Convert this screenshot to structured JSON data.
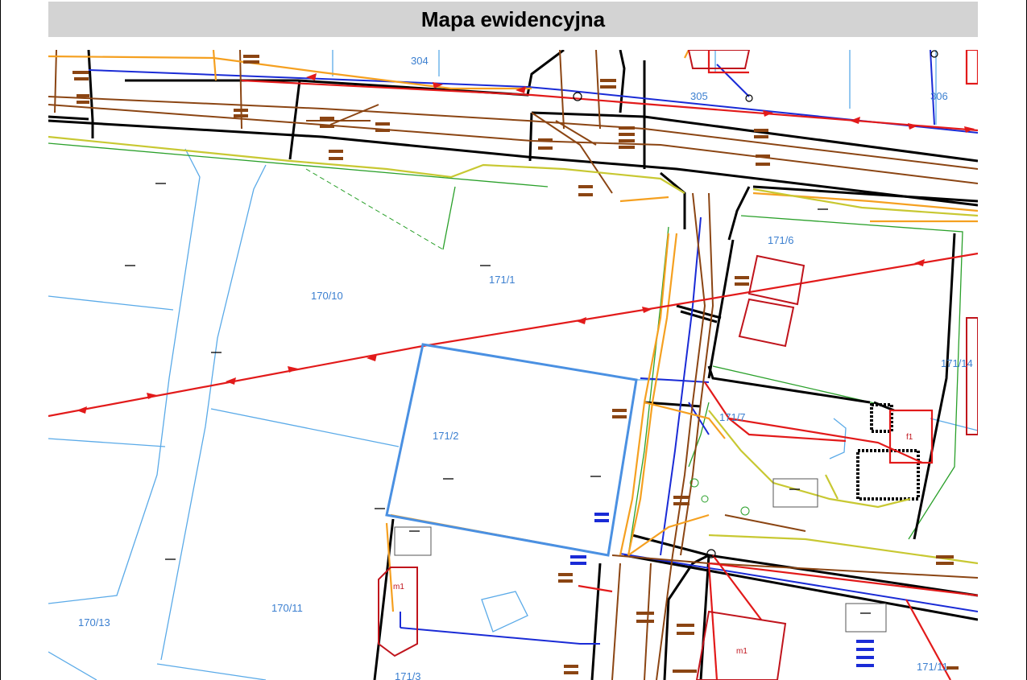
{
  "title": "Mapa ewidencyjna",
  "parcels": {
    "p304": "304",
    "p305": "305",
    "p306": "306",
    "p171_6": "171/6",
    "p171_1": "171/1",
    "p170_10": "170/10",
    "p171_14": "171/14",
    "p171_2": "171/2",
    "p170_11": "170/11",
    "p170_13": "170/13",
    "p171_11": "171/11",
    "p171_3": "171/3",
    "p171_7": "171/7"
  },
  "buildings": {
    "m1": "m1",
    "m1b": "m1",
    "f1": "f1"
  },
  "colors": {
    "parcel_lines": "#5aaae8",
    "selected_parcel": "#4a90e2",
    "gas_red": "#e21a1a",
    "sewer_brown": "#8b4513",
    "water_blue": "#1a2bd6",
    "power_orange": "#f5a020",
    "telecom_yellow": "#c8c832",
    "curb_black": "#000000",
    "green_line": "#2aa02a"
  }
}
